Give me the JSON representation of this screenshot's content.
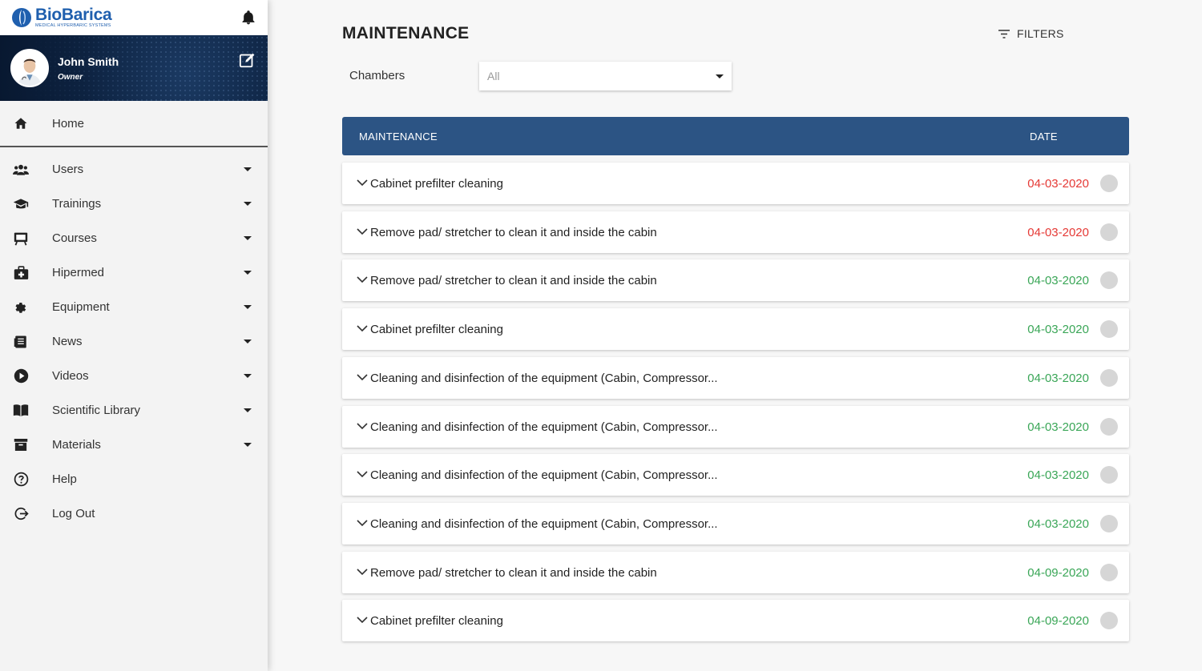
{
  "brand": {
    "name": "BioBarica",
    "subtitle": "MEDICAL HYPERBARIC SYSTEMS"
  },
  "user": {
    "name": "John Smith",
    "role": "Owner"
  },
  "sidebar": {
    "home": "Home",
    "items": [
      {
        "label": "Users",
        "icon": "users-icon"
      },
      {
        "label": "Trainings",
        "icon": "graduation-cap-icon"
      },
      {
        "label": "Courses",
        "icon": "presentation-board-icon"
      },
      {
        "label": "Hipermed",
        "icon": "medical-kit-icon"
      },
      {
        "label": "Equipment",
        "icon": "gear-icon"
      },
      {
        "label": "News",
        "icon": "newspaper-icon"
      },
      {
        "label": "Videos",
        "icon": "play-circle-icon"
      },
      {
        "label": "Scientific Library",
        "icon": "book-icon"
      },
      {
        "label": "Materials",
        "icon": "archive-box-icon"
      }
    ],
    "help": "Help",
    "logout": "Log Out"
  },
  "main": {
    "title": "MAINTENANCE",
    "filters_label": "FILTERS",
    "chambers_label": "Chambers",
    "chambers_value": "All",
    "table": {
      "col_maintenance": "MAINTENANCE",
      "col_date": "DATE",
      "rows": [
        {
          "title": "Cabinet prefilter cleaning",
          "date": "04-03-2020",
          "status": "overdue"
        },
        {
          "title": "Remove pad/ stretcher to clean it and inside the cabin",
          "date": "04-03-2020",
          "status": "overdue"
        },
        {
          "title": "Remove pad/ stretcher to clean it and inside the cabin",
          "date": "04-03-2020",
          "status": "ok"
        },
        {
          "title": "Cabinet prefilter cleaning",
          "date": "04-03-2020",
          "status": "ok"
        },
        {
          "title": "Cleaning and disinfection of the equipment (Cabin, Compressor...",
          "date": "04-03-2020",
          "status": "ok"
        },
        {
          "title": "Cleaning and disinfection of the equipment (Cabin, Compressor...",
          "date": "04-03-2020",
          "status": "ok"
        },
        {
          "title": "Cleaning and disinfection of the equipment (Cabin, Compressor...",
          "date": "04-03-2020",
          "status": "ok"
        },
        {
          "title": "Cleaning and disinfection of the equipment (Cabin, Compressor...",
          "date": "04-03-2020",
          "status": "ok"
        },
        {
          "title": "Remove pad/ stretcher to clean it and inside the cabin",
          "date": "04-09-2020",
          "status": "ok"
        },
        {
          "title": "Cabinet prefilter cleaning",
          "date": "04-09-2020",
          "status": "ok"
        }
      ]
    }
  },
  "colors": {
    "header_bg": "#2c5484",
    "overdue": "#e53935",
    "ok": "#3aa657",
    "brand": "#1f5fae"
  }
}
